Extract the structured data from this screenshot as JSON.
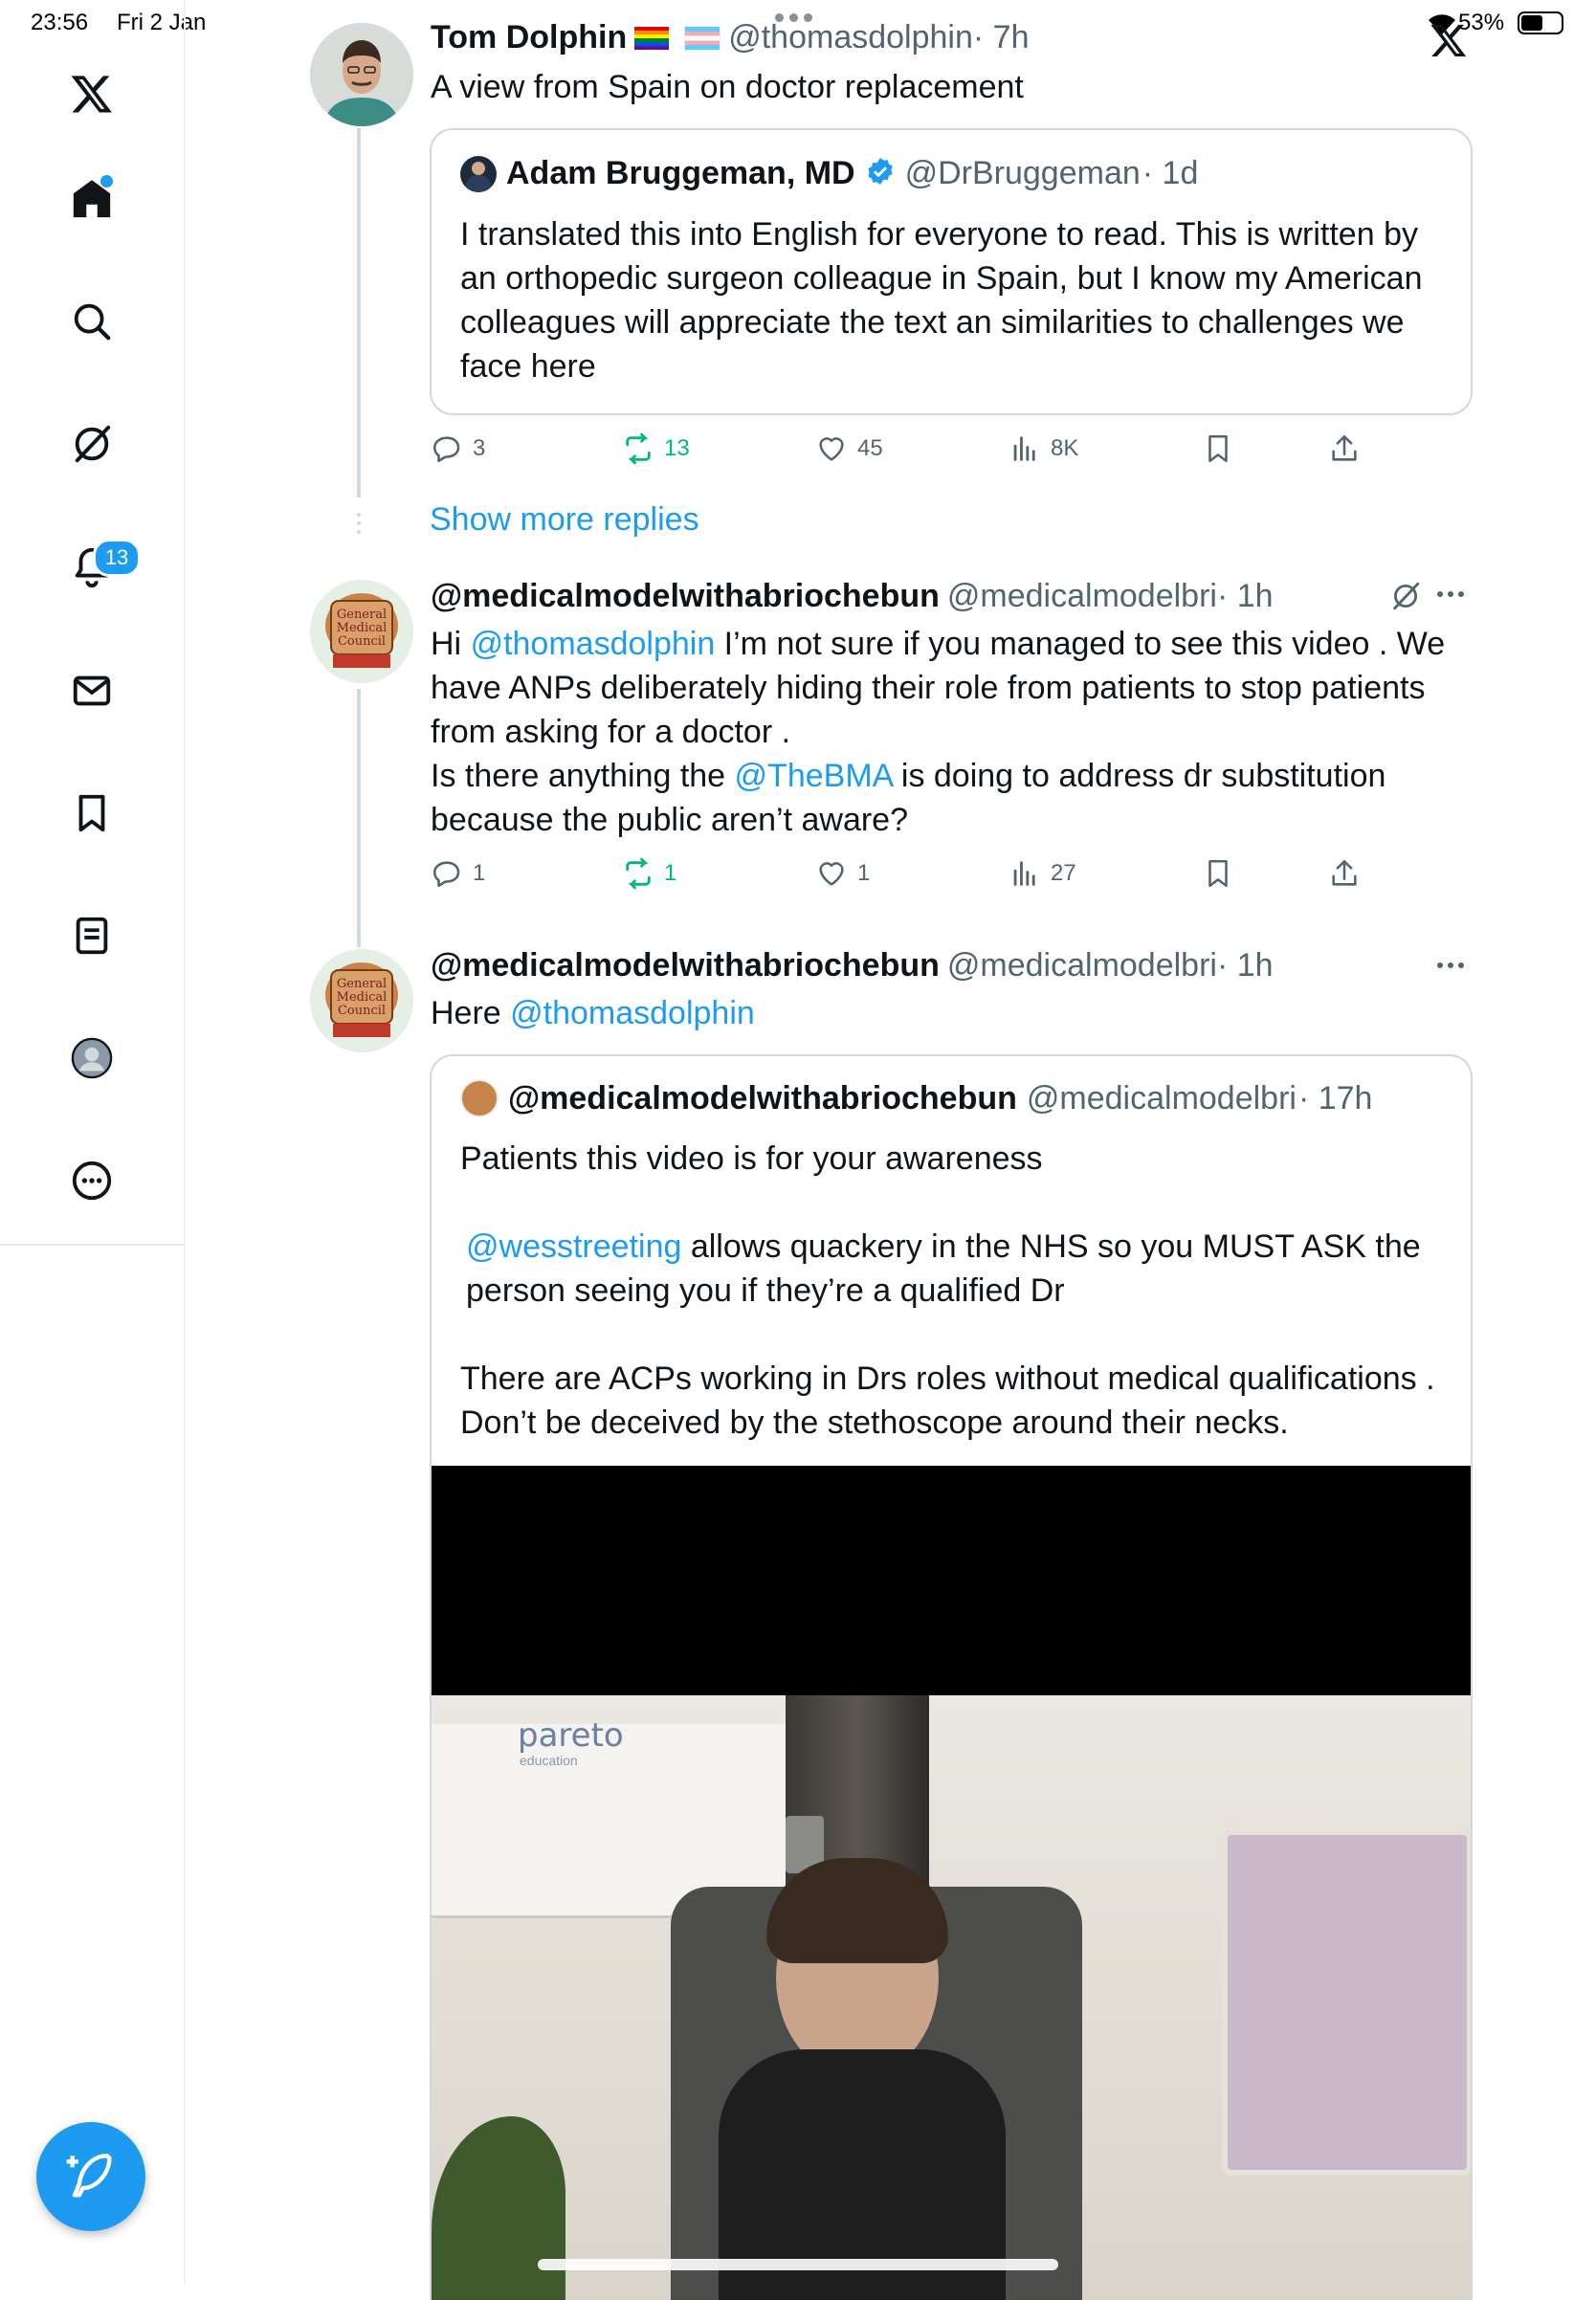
{
  "status_bar": {
    "time": "23:56",
    "date": "Fri 2 Jan",
    "battery": "53%"
  },
  "sidebar": {
    "items": [
      {
        "name": "x-logo-icon"
      },
      {
        "name": "home-icon"
      },
      {
        "name": "search-icon"
      },
      {
        "name": "grok-icon"
      },
      {
        "name": "notifications-icon"
      },
      {
        "name": "messages-icon"
      },
      {
        "name": "bookmarks-icon"
      },
      {
        "name": "lists-icon"
      },
      {
        "name": "profile-icon"
      },
      {
        "name": "more-icon"
      }
    ],
    "notification_count": "13",
    "compose_icon": "compose-icon"
  },
  "tweet1": {
    "name": "Tom Dolphin",
    "handle": "@thomasdolphin",
    "time": "· 7h",
    "text": "A view from Spain on doctor replacement",
    "quote": {
      "name": "Adam Bruggeman, MD",
      "handle": "@DrBruggeman",
      "time": "· 1d",
      "text": "I translated this into English for everyone to read. This is written by an orthopedic surgeon colleague in Spain, but I know my American colleagues will appreciate the text an similarities to challenges we face here"
    },
    "actions": {
      "replies": "3",
      "retweets": "13",
      "likes": "45",
      "views": "8K"
    }
  },
  "show_more_replies": "Show more replies",
  "tweet2": {
    "name": "@medicalmodelwithabriochebun",
    "handle": "@medicalmodelbri",
    "time": "· 1h",
    "text_p1": "Hi ",
    "mention1": "@thomasdolphin",
    "text_p2": " I’m not sure if you managed to see this video  . We have ANPs deliberately hiding their role from patients to stop patients from asking for a doctor .",
    "text_p3": "Is there anything the ",
    "mention2": "@TheBMA",
    "text_p4": " is doing to address dr substitution because the public aren’t aware?",
    "actions": {
      "replies": "1",
      "retweets": "1",
      "likes": "1",
      "views": "27"
    }
  },
  "tweet3": {
    "name": "@medicalmodelwithabriochebun",
    "handle": "@medicalmodelbri",
    "time": "· 1h",
    "text_p1": "Here ",
    "mention1": "@thomasdolphin",
    "quote": {
      "name": "@medicalmodelwithabriochebun",
      "handle": "@medicalmodelbri",
      "time": "· 17h",
      "line1": "Patients this video is for your awareness",
      "mention": "@wesstreeting",
      "line2": " allows quackery in the NHS so you MUST ASK the person seeing you if they’re a qualified Dr",
      "line3": "There are ACPs working in Drs roles without medical qualifications . Don’t be deceived by the stethoscope around their necks."
    },
    "video": {
      "brand": "pareto",
      "brand_sub": "education"
    }
  },
  "colors": {
    "accent": "#1d9bf0",
    "retweet": "#00ba7c",
    "secondary_text": "#536471",
    "border": "#cfd9de"
  }
}
